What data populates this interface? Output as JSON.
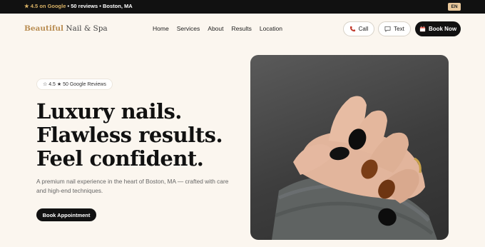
{
  "topbar": {
    "rating": "★ 4.5 on Google",
    "separator": "•",
    "reviews": "50 reviews",
    "location": "Boston, MA",
    "language": "EN"
  },
  "brand": {
    "accent": "Beautiful",
    "rest": "Nail & Spa"
  },
  "nav": {
    "items": [
      "Home",
      "Services",
      "About",
      "Results",
      "Location"
    ]
  },
  "actions": {
    "call_label": "Call",
    "text_label": "Text",
    "book_label": "Book Now"
  },
  "hero": {
    "badge": "☆ 4.5 ★ 50 Google Reviews",
    "headline": [
      "Luxury nails.",
      "Flawless results.",
      "Feel confident."
    ],
    "description": "A premium nail experience in the heart of Boston, MA — crafted with care and high-end techniques.",
    "cta_label": "Book Appointment"
  },
  "colors": {
    "accent_gold": "#b98d52",
    "background": "#fbf6ef",
    "dark": "#111111"
  },
  "icons": {
    "call": "phone-icon",
    "text": "message-icon",
    "book": "calendar-icon"
  }
}
